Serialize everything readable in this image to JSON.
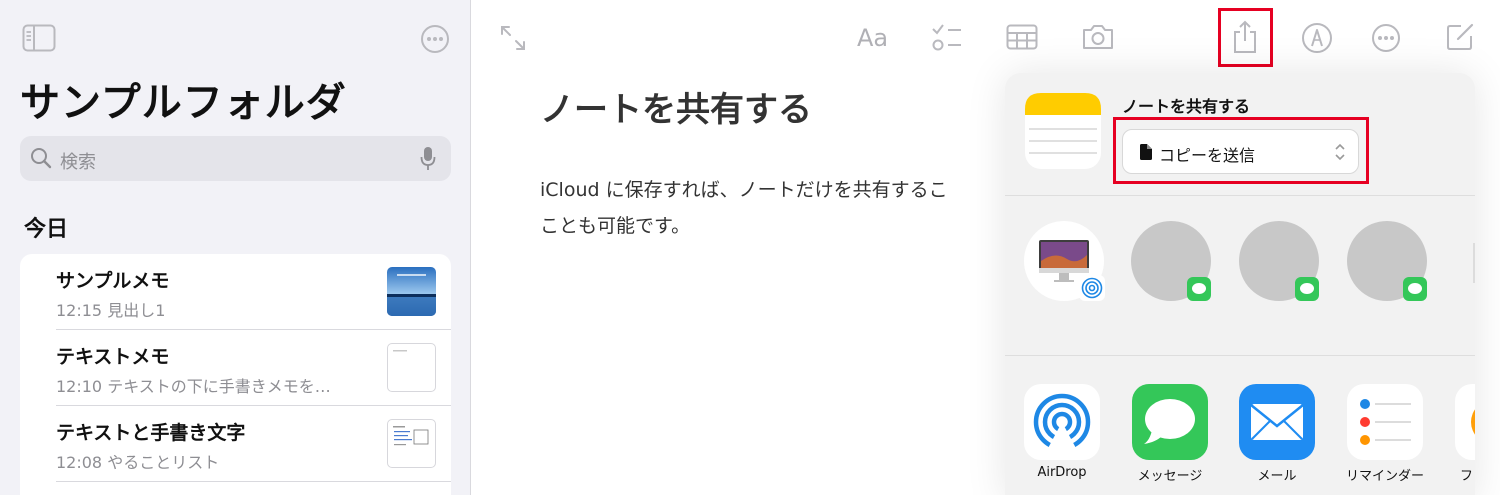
{
  "sidebar": {
    "folder_title": "サンプルフォルダ",
    "search_placeholder": "検索",
    "section_title": "今日",
    "notes": [
      {
        "title": "サンプルメモ",
        "subtitle": "12:15  見出し1"
      },
      {
        "title": "テキストメモ",
        "subtitle": "12:10  テキストの下に手書きメモを…"
      },
      {
        "title": "テキストと手書き文字",
        "subtitle": "12:08  やることリスト"
      }
    ]
  },
  "toolbar": {
    "format_label": "Aa"
  },
  "note": {
    "title": "ノートを共有する",
    "body_line1": "iCloud に保存すれば、ノートだけを共有するこ",
    "body_line2": "ことも可能です。"
  },
  "share_sheet": {
    "title": "ノートを共有する",
    "send_option": "コピーを送信",
    "apps": [
      {
        "label": "AirDrop"
      },
      {
        "label": "メッセージ"
      },
      {
        "label": "メール"
      },
      {
        "label": "リマインダー"
      },
      {
        "label": "フリ"
      }
    ]
  },
  "colors": {
    "highlight": "#e60022",
    "accent": "#007aff",
    "messages_green": "#34c759",
    "notes_yellow": "#ffcc00"
  }
}
